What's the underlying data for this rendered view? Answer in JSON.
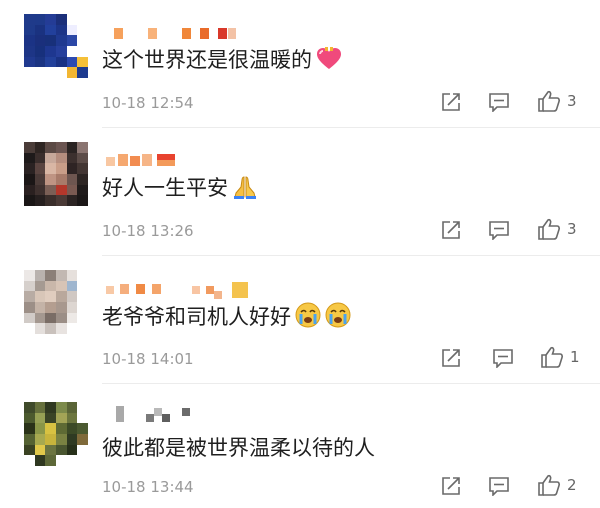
{
  "comments": [
    {
      "username": "",
      "text": "这个世界还是很温暖的",
      "emoji": "heart-gift-icon",
      "time": "10-18 12:54",
      "likes": "3"
    },
    {
      "username": "",
      "text": "好人一生平安",
      "emoji": "praying-hands-icon",
      "time": "10-18 13:26",
      "likes": "3"
    },
    {
      "username": "",
      "text": "老爷爷和司机人好好",
      "emoji": "crying-face-icon",
      "time": "10-18 14:01",
      "likes": "1"
    },
    {
      "username": "",
      "text": "彼此都是被世界温柔以待的人",
      "emoji": "",
      "time": "10-18 13:44",
      "likes": "2"
    }
  ],
  "icons": {
    "share": "share-icon",
    "comment": "comment-icon",
    "like": "thumbs-up-icon"
  },
  "colors": {
    "meta_text": "#9a9a9a",
    "icon": "#6a6a6a",
    "divider": "#ececec"
  }
}
